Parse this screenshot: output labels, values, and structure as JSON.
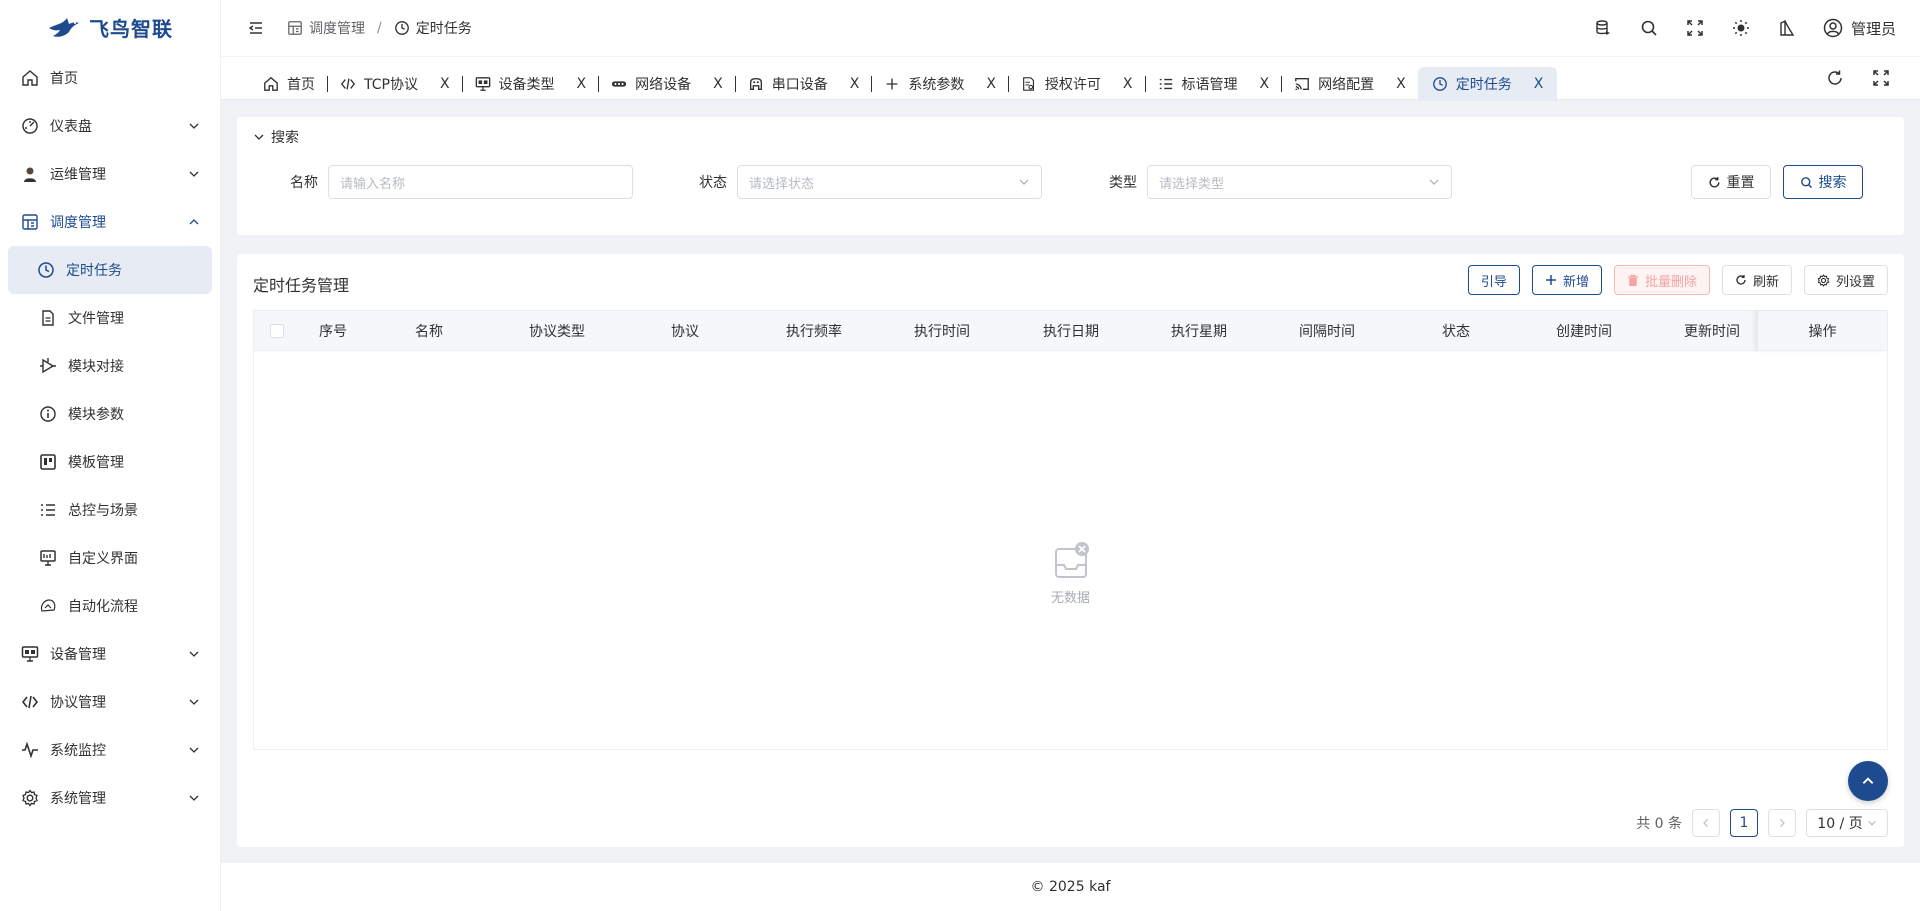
{
  "colors": {
    "accent": "#1e4b8f",
    "active_bg": "#e6ebf4",
    "danger": "#f56c6c"
  },
  "logo": {
    "text": "飞鸟智联",
    "icon": "bird-logo-icon"
  },
  "sidebar": {
    "items": [
      {
        "label": "首页",
        "icon": "home-icon"
      },
      {
        "label": "仪表盘",
        "icon": "dashboard-icon"
      },
      {
        "label": "运维管理",
        "icon": "operator-icon"
      },
      {
        "label": "调度管理",
        "icon": "schedule-icon"
      },
      {
        "label": "定时任务",
        "icon": "clock-icon"
      },
      {
        "label": "文件管理",
        "icon": "file-icon"
      },
      {
        "label": "模块对接",
        "icon": "module-link-icon"
      },
      {
        "label": "模块参数",
        "icon": "info-icon"
      },
      {
        "label": "模板管理",
        "icon": "template-icon"
      },
      {
        "label": "总控与场景",
        "icon": "list-icon"
      },
      {
        "label": "自定义界面",
        "icon": "monitor-icon"
      },
      {
        "label": "自动化流程",
        "icon": "flow-icon"
      },
      {
        "label": "设备管理",
        "icon": "device-icon"
      },
      {
        "label": "协议管理",
        "icon": "protocol-icon"
      },
      {
        "label": "系统监控",
        "icon": "pulse-icon"
      },
      {
        "label": "系统管理",
        "icon": "gear-icon"
      }
    ]
  },
  "header": {
    "breadcrumb": [
      "调度管理",
      "定时任务"
    ],
    "separator": "/",
    "user": "管理员"
  },
  "tabs": [
    {
      "label": "首页",
      "icon": "home-icon"
    },
    {
      "label": "TCP协议",
      "icon": "code-icon"
    },
    {
      "label": "设备类型",
      "icon": "device-icon"
    },
    {
      "label": "网络设备",
      "icon": "network-icon"
    },
    {
      "label": "串口设备",
      "icon": "serial-icon"
    },
    {
      "label": "系统参数",
      "icon": "plus-icon"
    },
    {
      "label": "授权许可",
      "icon": "license-icon"
    },
    {
      "label": "标语管理",
      "icon": "list-icon"
    },
    {
      "label": "网络配置",
      "icon": "cast-icon"
    },
    {
      "label": "定时任务",
      "icon": "clock-icon"
    }
  ],
  "tab_close": "X",
  "search": {
    "title": "搜索",
    "name_label": "名称",
    "name_placeholder": "请输入名称",
    "status_label": "状态",
    "status_placeholder": "请选择状态",
    "type_label": "类型",
    "type_placeholder": "请选择类型",
    "reset_label": "重置",
    "search_label": "搜索"
  },
  "table": {
    "title": "定时任务管理",
    "toolbar": {
      "guide": "引导",
      "add": "新增",
      "batch_delete": "批量删除",
      "refresh": "刷新",
      "columns": "列设置"
    },
    "columns": [
      "序号",
      "名称",
      "协议类型",
      "协议",
      "执行频率",
      "执行时间",
      "执行日期",
      "执行星期",
      "间隔时间",
      "状态",
      "创建时间",
      "更新时间"
    ],
    "op_column": "操作",
    "empty_text": "无数据"
  },
  "pagination": {
    "total_text": "共 0 条",
    "current_page": "1",
    "page_size": "10 / 页"
  },
  "footer": "© 2025 kaf"
}
